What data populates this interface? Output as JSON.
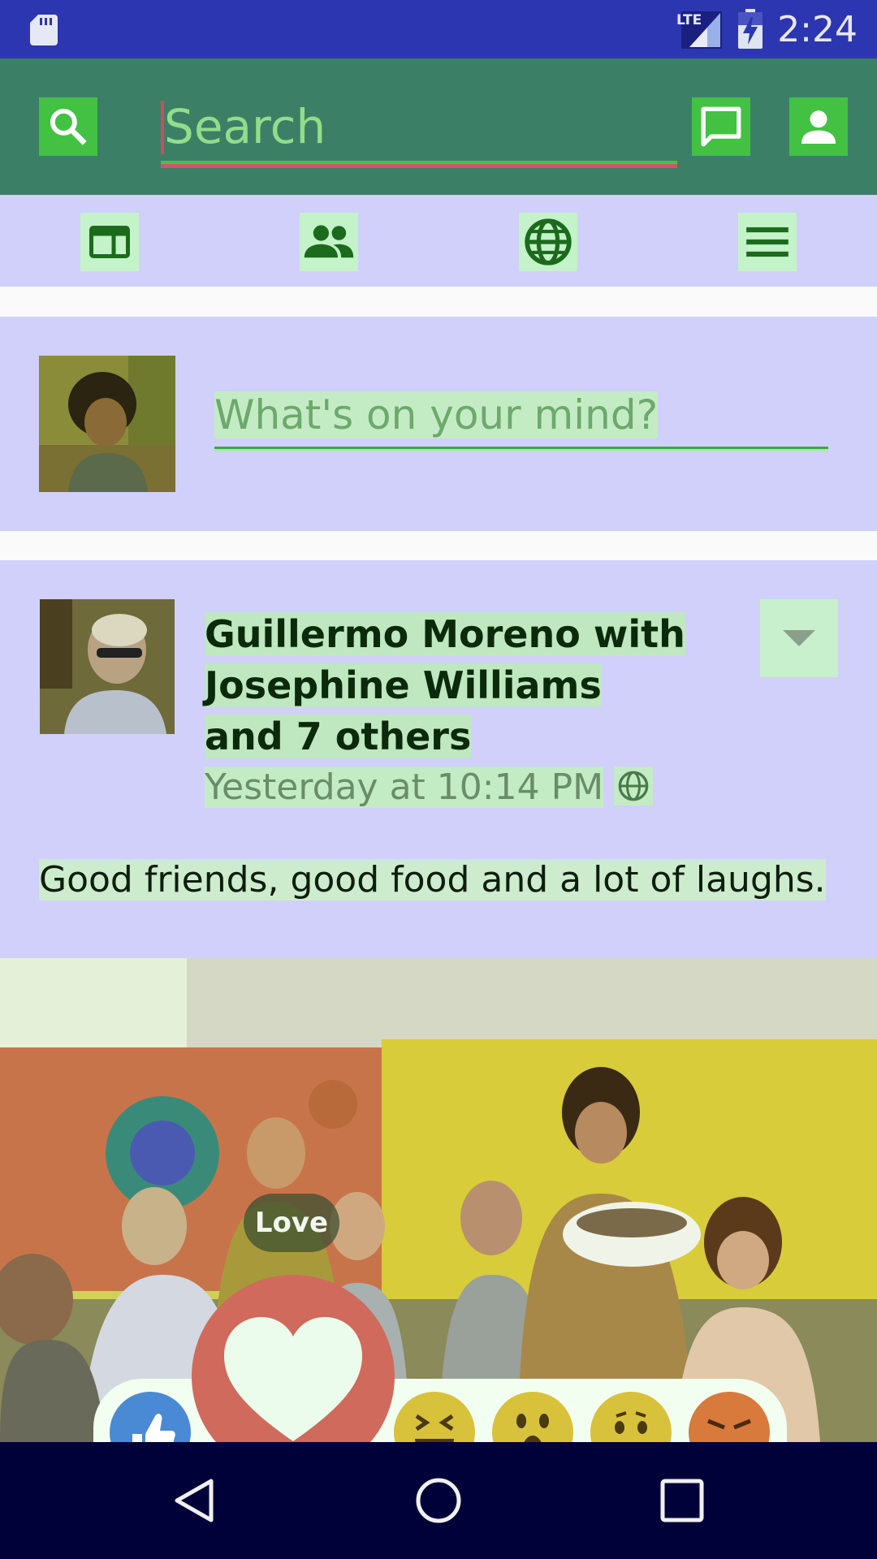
{
  "status_bar": {
    "time": "2:24",
    "network_label": "LTE",
    "icons": [
      "sd-card-icon",
      "lte-signal-icon",
      "battery-charging-icon"
    ]
  },
  "toolbar": {
    "search_placeholder": "Search",
    "icons": [
      "search-icon",
      "messenger-icon",
      "person-icon"
    ],
    "accent_color": "#3b8066"
  },
  "tabs": [
    {
      "name": "news-feed",
      "icon": "news-feed-icon"
    },
    {
      "name": "friends",
      "icon": "friends-icon"
    },
    {
      "name": "notifications",
      "icon": "globe-icon"
    },
    {
      "name": "menu",
      "icon": "menu-icon"
    }
  ],
  "composer": {
    "placeholder": "What's on your mind?"
  },
  "post": {
    "author_line1": "Guillermo Moreno with",
    "author_line2": "Josephine Williams",
    "author_line3": "and 7 others",
    "timestamp": "Yesterday at 10:14 PM",
    "privacy_icon": "globe-icon",
    "text": "Good friends, good food and a lot of laughs."
  },
  "reactions": {
    "highlighted_label": "Love",
    "items": [
      "like",
      "love",
      "haha",
      "wow",
      "sad",
      "angry"
    ]
  },
  "navbar": {
    "icons": [
      "back-icon",
      "home-icon",
      "recents-icon"
    ]
  }
}
